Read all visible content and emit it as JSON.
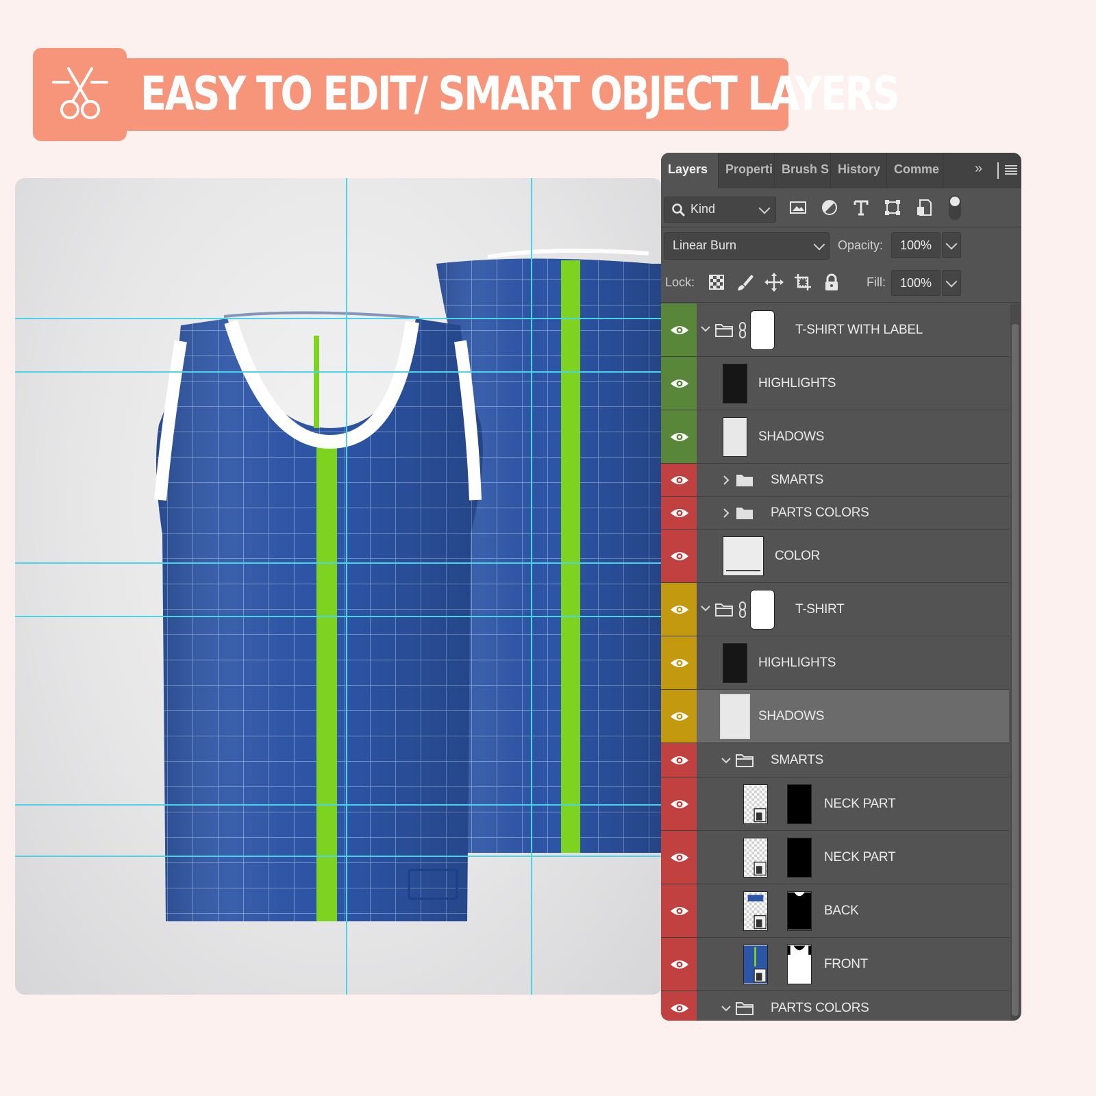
{
  "banner": {
    "title": "EASY TO EDIT/ SMART OBJECT LAYERS",
    "icon": "scissors-icon"
  },
  "canvas": {
    "background_color": "#e3e3e4",
    "guide_color": "#49d4e8",
    "shirt_color": "#2d55a6",
    "stripe_color": "#7ed321"
  },
  "panel": {
    "tabs": [
      {
        "label": "Layers",
        "active": true
      },
      {
        "label": "Properti",
        "active": false
      },
      {
        "label": "Brush S",
        "active": false
      },
      {
        "label": "History",
        "active": false
      },
      {
        "label": "Comme",
        "active": false
      }
    ],
    "more_label": "»",
    "filter": {
      "kind_label": "Kind"
    },
    "blend_mode": "Linear Burn",
    "opacity_label": "Opacity:",
    "opacity_value": "100%",
    "lock_label": "Lock:",
    "fill_label": "Fill:",
    "fill_value": "100%"
  },
  "layers": [
    {
      "name": "T-SHIRT WITH LABEL",
      "kind": "group-open",
      "label_color": "green",
      "depth": 0
    },
    {
      "name": "HIGHLIGHTS",
      "kind": "pixel-dark",
      "label_color": "green",
      "depth": 1
    },
    {
      "name": "SHADOWS",
      "kind": "pixel-light",
      "label_color": "green",
      "depth": 1
    },
    {
      "name": "SMARTS",
      "kind": "group-closed",
      "label_color": "red",
      "depth": 1
    },
    {
      "name": "PARTS COLORS",
      "kind": "group-closed",
      "label_color": "red",
      "depth": 1
    },
    {
      "name": "COLOR",
      "kind": "fill",
      "label_color": "red",
      "depth": 1
    },
    {
      "name": "T-SHIRT",
      "kind": "group-open",
      "label_color": "yellow",
      "depth": 0
    },
    {
      "name": "HIGHLIGHTS",
      "kind": "pixel-dark",
      "label_color": "yellow",
      "depth": 1
    },
    {
      "name": "SHADOWS",
      "kind": "pixel-light",
      "label_color": "yellow",
      "depth": 1,
      "selected": true
    },
    {
      "name": "SMARTS",
      "kind": "group-open",
      "label_color": "red",
      "depth": 1
    },
    {
      "name": "NECK PART",
      "kind": "smart-masked",
      "label_color": "red",
      "depth": 2
    },
    {
      "name": "NECK PART",
      "kind": "smart-masked",
      "label_color": "red",
      "depth": 2
    },
    {
      "name": "BACK",
      "kind": "smart-masked",
      "label_color": "red",
      "depth": 2
    },
    {
      "name": "FRONT",
      "kind": "smart-masked",
      "label_color": "red",
      "depth": 2
    },
    {
      "name": "PARTS COLORS",
      "kind": "group-open",
      "label_color": "red",
      "depth": 1
    }
  ],
  "label_colors": {
    "green": "#58873a",
    "red": "#c0413f",
    "yellow": "#c39a0f"
  }
}
